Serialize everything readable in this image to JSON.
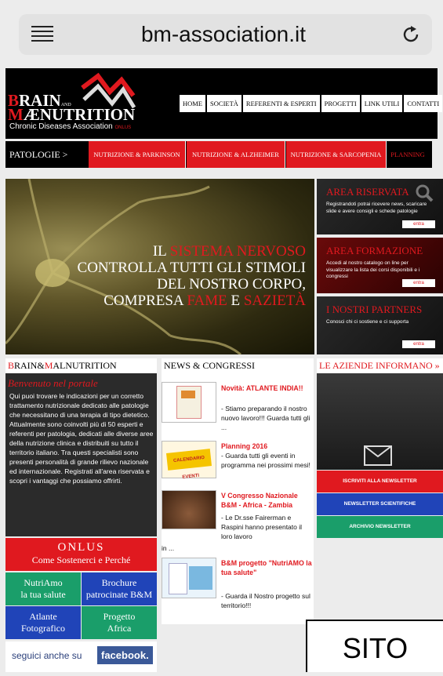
{
  "browser": {
    "url": "bm-association.it"
  },
  "logo": {
    "line1a": "B",
    "line1b": "RAIN",
    "and": "AND",
    "line2a": "M",
    "line2b": "Æ",
    "line2c": "NUTRITION",
    "line3": "Chronic Diseases Association",
    "onlus": "ONLUS"
  },
  "nav": [
    "HOME",
    "SOCIETÀ",
    "REFERENTI & ESPERTI",
    "PROGETTI",
    "LINK UTILI",
    "CONTATTI"
  ],
  "patologie": {
    "label": "PATOLOGIE >",
    "items": [
      "NUTRIZIONE & PARKINSON",
      "NUTRIZIONE & ALZHEIMER",
      "NUTRIZIONE & SARCOPENIA",
      "PLANNING"
    ]
  },
  "hero": {
    "il": "IL ",
    "sistema": "SISTEMA NERVOSO",
    "line2": "CONTROLLA TUTTI GLI STIMOLI",
    "line3": "DEL NOSTRO CORPO,",
    "compresa": "COMPRESA ",
    "fame": "FAME",
    "e": " E ",
    "sazieta": "SAZIETÀ"
  },
  "side_boxes": [
    {
      "title": "AREA RISERVATA",
      "desc": "Registrandoti potrai ricevere news, scaricare slide e avere consigli e schede patologie",
      "button": "entra"
    },
    {
      "title": "AREA FORMAZIONE",
      "desc": "Accedi al nostro catalogo on line per visualizzare la lista dei corsi disponibili e i congressi",
      "button": "entra"
    },
    {
      "title": "I NOSTRI PARTNERS",
      "desc": "Conosci chi ci sostiene e ci supporta",
      "button": "entra"
    }
  ],
  "left": {
    "header_a": "B",
    "header_b": "RAIN&",
    "header_c": "M",
    "header_d": "ALNUTRITION",
    "welcome_title": "Benvenuto nel portale",
    "welcome_text": "Qui puoi trovare le indicazioni per un corretto trattamento nutrizionale dedicato alle patologie che necessitano di una terapia di tipo dietetico. Attualmente sono coinvolti più di 50 esperti e referenti per patologia, dedicati alle diverse aree della nutrizione clinica e distribuiti su tutto il territorio italiano. Tra questi specialisti sono presenti personalità di grande rilievo nazionale ed internazionale. Registrati all'area riservata e scopri i vantaggi che possiamo offrirti.",
    "onlus_title": "ONLUS",
    "onlus_sub": "Come Sostenerci e Perché",
    "tiles": [
      {
        "l1": "NutriAmo",
        "l2": "la tua salute",
        "color": "#1a9e6a"
      },
      {
        "l1": "Brochure",
        "l2": "patrocinate B&M",
        "color": "#2044b8"
      },
      {
        "l1": "Atlante",
        "l2": "Fotografico",
        "color": "#2044b8"
      },
      {
        "l1": "Progetto",
        "l2": "Africa",
        "color": "#1a9e6a"
      }
    ],
    "social_text": "seguici anche su",
    "facebook": "facebook."
  },
  "news": {
    "header": "NEWS & CONGRESSI",
    "items": [
      {
        "title": "Novità: ATLANTE INDIA!!",
        "text": "- Stiamo preparando il nostro nuovo lavoro!!! Guarda tutti gli ..."
      },
      {
        "title": "Planning 2016",
        "text": "- Guarda tutti gli eventi in programma nei prossimi mesi!"
      },
      {
        "title": "V Congresso Nazionale B&M - Africa - Zambia",
        "text": "- Le Dr.sse Fairerman e Raspini hanno presentato il loro lavoro",
        "text2": "in ..."
      },
      {
        "title": "B&M progetto \"NutriAMO la tua salute\"",
        "text": "- Guarda il Nostro progetto sul territorio!!!"
      }
    ],
    "thumb_label": "CALENDARIO EVENTI"
  },
  "aziende": {
    "header": "LE AZIENDE INFORMANO »",
    "buttons": [
      {
        "label": "ISCRIVITI ALLA NEWSLETTER",
        "color": "#e0191f"
      },
      {
        "label": "NEWSLETTER SCIENTIFICHE",
        "color": "#2044b8"
      },
      {
        "label": "ARCHIVIO NEWSLETTER",
        "color": "#1a9e6a"
      }
    ]
  },
  "overlay": {
    "sito": "SITO"
  },
  "colors": {
    "accent_red": "#e0191f",
    "blue": "#2044b8",
    "green": "#1a9e6a"
  }
}
